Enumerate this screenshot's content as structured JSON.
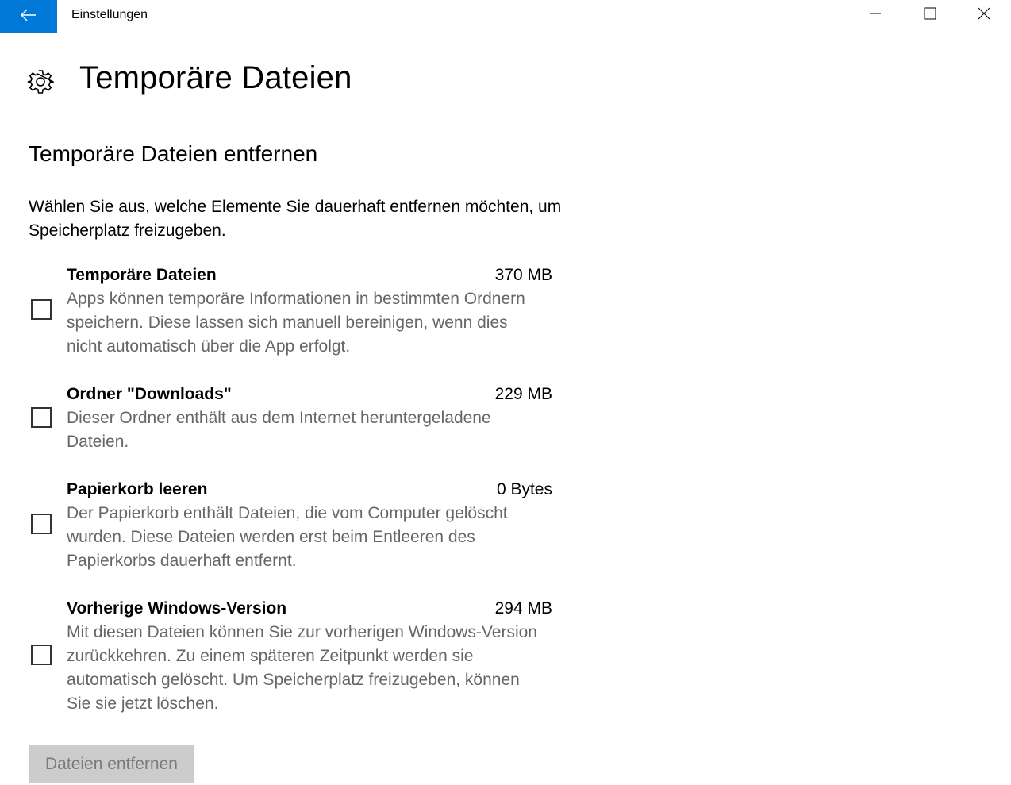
{
  "window": {
    "title": "Einstellungen",
    "back_icon": "arrow-left-icon",
    "accent_color": "#0078d7",
    "controls": [
      "minimize-icon",
      "maximize-icon",
      "close-icon"
    ]
  },
  "header": {
    "icon": "gear-icon",
    "title": "Temporäre Dateien"
  },
  "section": {
    "title": "Temporäre Dateien entfernen",
    "intro": "Wählen Sie aus, welche Elemente Sie dauerhaft entfernen möchten, um Speicherplatz freizugeben."
  },
  "items": [
    {
      "title": "Temporäre Dateien",
      "size": "370 MB",
      "description": "Apps können temporäre Informationen in bestimmten Ordnern speichern. Diese lassen sich manuell bereinigen, wenn dies nicht automatisch über die App erfolgt.",
      "checked": false
    },
    {
      "title": "Ordner \"Downloads\"",
      "size": "229 MB",
      "description": "Dieser Ordner enthält aus dem Internet heruntergeladene Dateien.",
      "checked": false
    },
    {
      "title": "Papierkorb leeren",
      "size": "0 Bytes",
      "description": "Der Papierkorb enthält Dateien, die vom Computer gelöscht wurden. Diese Dateien werden erst beim Entleeren des Papierkorbs dauerhaft entfernt.",
      "checked": false
    },
    {
      "title": "Vorherige Windows-Version",
      "size": "294 MB",
      "description": "Mit diesen Dateien können Sie zur vorherigen Windows-Version zurückkehren. Zu einem späteren Zeitpunkt werden sie automatisch gelöscht. Um Speicherplatz freizugeben, können Sie sie jetzt löschen.",
      "checked": false
    }
  ],
  "action": {
    "remove_label": "Dateien entfernen",
    "disabled": true
  }
}
